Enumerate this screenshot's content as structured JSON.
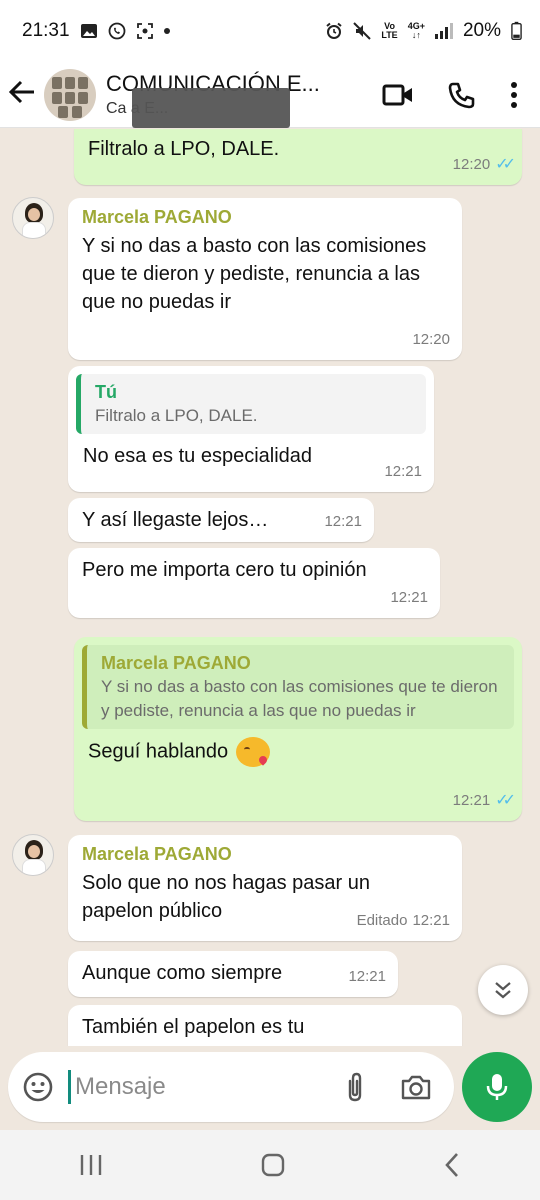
{
  "status_bar": {
    "time": "21:31",
    "lte_label_top": "Vo",
    "lte_label_bottom": "LTE",
    "net_label": "4G+",
    "battery": "20%"
  },
  "header": {
    "title": "COMUNICACIÓN E...",
    "subtitle": "Ca                             a E..."
  },
  "messages": {
    "m1": {
      "text": "Filtralo a LPO, DALE.",
      "time": "12:20",
      "status": "read"
    },
    "m2": {
      "sender": "Marcela PAGANO",
      "text": "Y si no das a basto con las comisiones que te dieron y pediste, renuncia a las que no puedas ir",
      "time": "12:20"
    },
    "m3": {
      "quote_name": "Tú",
      "quote_text": "Filtralo a LPO, DALE.",
      "text": "No esa es tu especialidad",
      "time": "12:21"
    },
    "m4": {
      "text": "Y así llegaste lejos…",
      "time": "12:21"
    },
    "m5": {
      "text": "Pero me importa cero tu opinión",
      "time": "12:21"
    },
    "m6": {
      "quote_name": "Marcela PAGANO",
      "quote_text": "Y si no das a basto con las comisiones que te dieron y pediste, renuncia a las que no puedas ir",
      "text": "Seguí hablando",
      "emoji": "kiss-emoji",
      "time": "12:21",
      "status": "read"
    },
    "m7": {
      "sender": "Marcela PAGANO",
      "text": "Solo que no nos hagas pasar un papelon público",
      "edited": "Editado",
      "time": "12:21"
    },
    "m8": {
      "text": "Aunque como siempre",
      "time": "12:21"
    },
    "m9": {
      "text": "También el papelon es tu"
    }
  },
  "composer": {
    "placeholder": "Mensaje"
  },
  "colors": {
    "accent": "#1fa855",
    "outgoing_bubble": "#dbf8c6",
    "sender_name": "#9ea936",
    "read_ticks": "#53bdeb",
    "chat_background": "#efe7de"
  },
  "icons": [
    "back-arrow-icon",
    "video-call-icon",
    "phone-icon",
    "more-options-icon",
    "emoji-icon",
    "attach-icon",
    "camera-icon",
    "mic-icon",
    "scroll-down-icon",
    "recent-apps-icon",
    "home-icon",
    "back-nav-icon"
  ]
}
